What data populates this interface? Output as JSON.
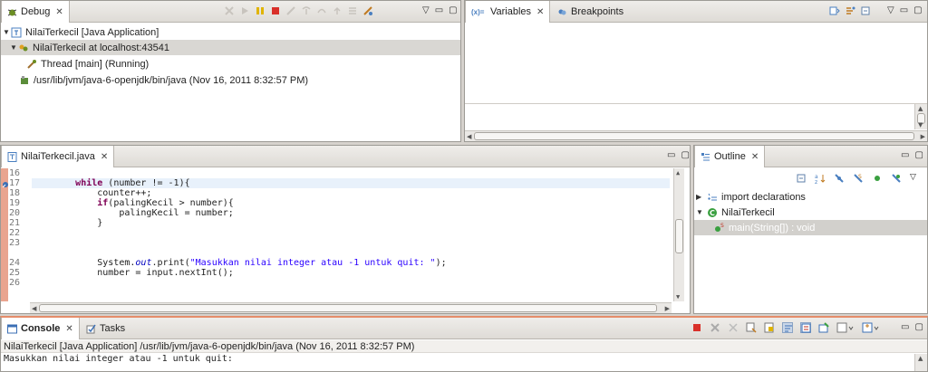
{
  "debug": {
    "tab_label": "Debug",
    "tree": [
      {
        "label": "NilaiTerkecil [Java Application]",
        "expanded": true
      },
      {
        "label": "NilaiTerkecil at localhost:43541",
        "expanded": true,
        "selected": true
      },
      {
        "label": "Thread [main] (Running)"
      },
      {
        "label": "/usr/lib/jvm/java-6-openjdk/bin/java (Nov 16, 2011 8:32:57 PM)"
      }
    ]
  },
  "variables": {
    "tabs": [
      {
        "label": "Variables",
        "icon": "variables-icon"
      },
      {
        "label": "Breakpoints",
        "icon": "breakpoints-icon"
      }
    ]
  },
  "editor": {
    "tab_label": "NilaiTerkecil.java",
    "lines": [
      {
        "num": "16",
        "text": ""
      },
      {
        "num": "17",
        "kw": "while",
        "rest": " (number != -1){",
        "indent": "        ",
        "current": true
      },
      {
        "num": "18",
        "indent": "            ",
        "rest": "counter++;"
      },
      {
        "num": "19",
        "indent": "            ",
        "kw": "if",
        "rest": "(palingKecil > number){"
      },
      {
        "num": "20",
        "indent": "                ",
        "rest": "palingKecil = number;"
      },
      {
        "num": "21",
        "indent": "            ",
        "rest": "}"
      },
      {
        "num": "22",
        "rest": ""
      },
      {
        "num": "23",
        "rest": ""
      },
      {
        "num": "24",
        "indent": "            ",
        "pre": "System.",
        "field": "out",
        "mid": ".print(",
        "str": "\"Masukkan nilai integer atau -1 untuk quit: \"",
        "post": ");"
      },
      {
        "num": "25",
        "indent": "            ",
        "rest": "number = input.nextInt();"
      },
      {
        "num": "26",
        "rest": ""
      }
    ]
  },
  "outline": {
    "tab_label": "Outline",
    "items": [
      {
        "label": "import declarations",
        "collapsed": true
      },
      {
        "label": "NilaiTerkecil",
        "expanded": true
      },
      {
        "label": "main(String[]) : void",
        "selected": true
      }
    ]
  },
  "console": {
    "tabs": [
      {
        "label": "Console"
      },
      {
        "label": "Tasks"
      }
    ],
    "header": "NilaiTerkecil [Java Application] /usr/lib/jvm/java-6-openjdk/bin/java (Nov 16, 2011 8:32:57 PM)",
    "output": "Masukkan nilai integer atau -1 untuk quit:"
  },
  "colors": {
    "keyword": "#7f0055",
    "string": "#2a00ff",
    "field": "#0000c0",
    "current_line": "#e8f1fb",
    "ruler": "#e9a48f"
  }
}
